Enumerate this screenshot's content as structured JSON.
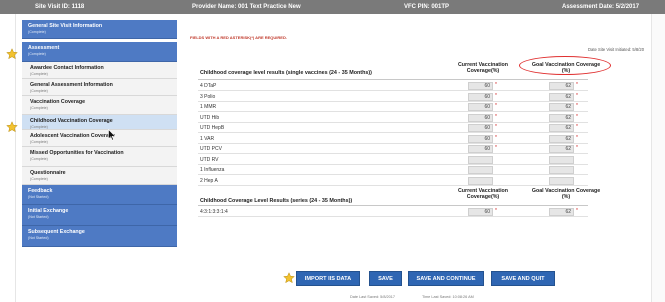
{
  "header": {
    "site_visit_id": "Site Visit ID: 1118",
    "provider_name": "Provider Name: 001 Text Practice New",
    "vfc_pin": "VFC PIN: 001TP",
    "assessment_date": "Assessment Date: 5/2/2017"
  },
  "sidebar": {
    "items": [
      {
        "label": "General Site Visit Information",
        "status": "(Complete)"
      },
      {
        "label": "Assessment",
        "status": "(Complete)"
      },
      {
        "label": "Awardee Contact Information",
        "status": "(Complete)"
      },
      {
        "label": "General Assessment Information",
        "status": "(Complete)"
      },
      {
        "label": "Vaccination Coverage",
        "status": "(Complete)"
      },
      {
        "label": "Childhood Vaccination Coverage",
        "status": "(Complete)"
      },
      {
        "label": "Adolescent Vaccination Coverage",
        "status": "(Complete)"
      },
      {
        "label": "Missed Opportunities for Vaccination",
        "status": "(Complete)"
      },
      {
        "label": "Questionnaire",
        "status": "(Complete)"
      },
      {
        "label": "Feedback",
        "status": "(Not Started)"
      },
      {
        "label": "Initial Exchange",
        "status": "(Not Started)"
      },
      {
        "label": "Subsequent Exchange",
        "status": "(Not Started)"
      }
    ]
  },
  "main": {
    "required_note": "FIELDS WITH A RED ASTERISK(*) ARE REQUIRED.",
    "initiated": "Date Site Visit Initiated: 5/8/20",
    "table1": {
      "title": "Childhood coverage level results (single vaccines (24 - 35 Months))",
      "current_header_1": "Current Vaccination",
      "current_header_2": "Coverage(%)",
      "goal_header_1": "Goal Vaccination Coverage",
      "goal_header_2": "(%)",
      "rows": [
        {
          "label": "4 DTaP",
          "current": "60",
          "goal": "62"
        },
        {
          "label": "3 Polio",
          "current": "60",
          "goal": "62"
        },
        {
          "label": "1 MMR",
          "current": "60",
          "goal": "62"
        },
        {
          "label": "UTD Hib",
          "current": "60",
          "goal": "62"
        },
        {
          "label": "UTD HepB",
          "current": "60",
          "goal": "62"
        },
        {
          "label": "1 VAR",
          "current": "60",
          "goal": "62"
        },
        {
          "label": "UTD PCV",
          "current": "60",
          "goal": "62"
        },
        {
          "label": "UTD RV",
          "current": "",
          "goal": ""
        },
        {
          "label": "1 Influenza",
          "current": "",
          "goal": ""
        },
        {
          "label": "2 Hep A",
          "current": "",
          "goal": ""
        }
      ]
    },
    "table2": {
      "title": "Childhood Coverage Level Results (series (24 - 35 Months))",
      "current_header_1": "Current Vaccination",
      "current_header_2": "Coverage(%)",
      "goal_header_1": "Goal Vaccination Coverage",
      "goal_header_2": "(%)",
      "rows": [
        {
          "label": "4:3:1:3:3:1:4",
          "current": "60",
          "goal": "62"
        }
      ]
    },
    "required_mark": "*"
  },
  "buttons": {
    "import": "IMPORT IIS DATA",
    "save": "SAVE",
    "save_continue": "SAVE AND CONTINUE",
    "save_quit": "SAVE AND QUIT"
  },
  "footer": {
    "date_last_saved": "Date Last Saved: 5/8/2017",
    "time_last_saved": "Time Last Saved: 10:08:26 AM"
  },
  "colors": {
    "nav_blue": "#4e7ac4",
    "button_blue": "#2f66b3",
    "required_red": "#d02020",
    "star_yellow": "#f2c230"
  },
  "icons": [
    "star-icon",
    "mouse-cursor-icon"
  ]
}
